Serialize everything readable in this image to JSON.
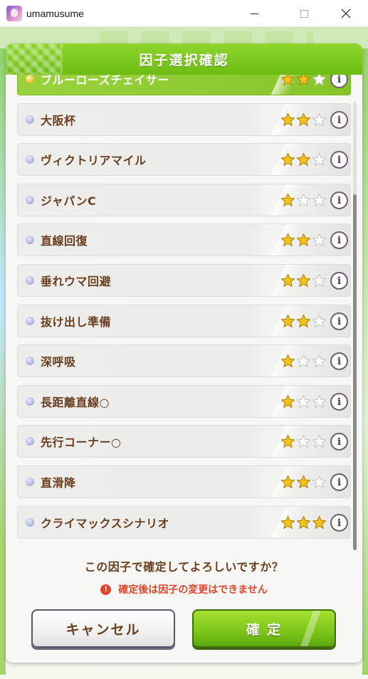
{
  "window": {
    "title": "umamusume",
    "icon": "umamusume-app-icon",
    "controls": [
      "minimize-icon",
      "maximize-icon",
      "close-icon"
    ]
  },
  "dialog": {
    "title": "因子選択確認",
    "factors": [
      {
        "label": "ブルーローズチェイサー",
        "stars": 2,
        "selected": true
      },
      {
        "label": "大阪杯",
        "stars": 2,
        "selected": false
      },
      {
        "label": "ヴィクトリアマイル",
        "stars": 2,
        "selected": false
      },
      {
        "label": "ジャパンC",
        "stars": 1,
        "selected": false
      },
      {
        "label": "直線回復",
        "stars": 2,
        "selected": false
      },
      {
        "label": "垂れウマ回避",
        "stars": 2,
        "selected": false
      },
      {
        "label": "抜け出し準備",
        "stars": 2,
        "selected": false
      },
      {
        "label": "深呼吸",
        "stars": 1,
        "selected": false
      },
      {
        "label": "長距離直線○",
        "stars": 1,
        "selected": false
      },
      {
        "label": "先行コーナー○",
        "stars": 1,
        "selected": false
      },
      {
        "label": "直滑降",
        "stars": 2,
        "selected": false
      },
      {
        "label": "クライマックスシナリオ",
        "stars": 3,
        "selected": false
      }
    ],
    "max_stars": 3,
    "info_label": "i",
    "question": "この因子で確定してよろしいですか？",
    "warning_icon_label": "!",
    "warning": "確定後は因子の変更はできません",
    "cancel_label": "キャンセル",
    "confirm_label": "確 定"
  },
  "colors": {
    "header_green": "#7cc51a",
    "text_brown": "#6b3e1e",
    "warning_red": "#e2452b",
    "star_gold": "#f5c21a"
  }
}
